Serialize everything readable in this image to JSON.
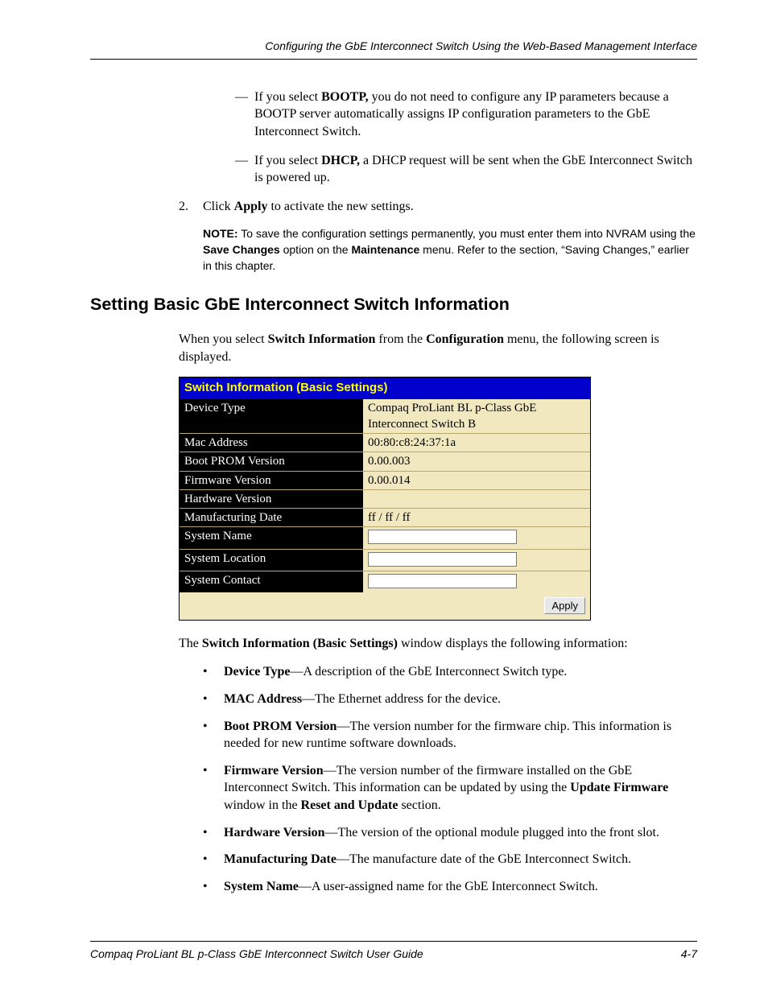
{
  "header": {
    "title": "Configuring the GbE Interconnect Switch Using the Web-Based Management Interface"
  },
  "footer": {
    "left": "Compaq ProLiant BL p-Class GbE Interconnect Switch User Guide",
    "right": "4-7"
  },
  "pre_list": {
    "item_a_prefix": "If you select ",
    "item_a_bold": "BOOTP,",
    "item_a_rest": " you do not need to configure any IP parameters because a BOOTP server automatically assigns IP configuration parameters to the GbE Interconnect Switch.",
    "item_b_prefix": "If you select ",
    "item_b_bold": "DHCP,",
    "item_b_rest": " a DHCP request will be sent when the GbE Interconnect Switch is powered up."
  },
  "step2": {
    "num": "2.",
    "prefix": "Click ",
    "bold": "Apply",
    "rest": " to activate the new settings."
  },
  "note": {
    "label": "NOTE:",
    "text1": "  To save the configuration settings permanently, you must enter them into NVRAM using the ",
    "bold1": "Save Changes",
    "text2": " option on the ",
    "bold2": "Maintenance",
    "text3": " menu. Refer to the section, “Saving Changes,” earlier in this chapter."
  },
  "section_title": "Setting Basic GbE Interconnect Switch Information",
  "intro": {
    "p1a": "When you select ",
    "p1b": "Switch Information",
    "p1c": " from the ",
    "p1d": "Configuration",
    "p1e": " menu, the following screen is displayed."
  },
  "panel": {
    "title": "Switch Information (Basic Settings)",
    "rows": [
      {
        "label": "Device Type",
        "value": "Compaq ProLiant BL p-Class GbE Interconnect Switch B",
        "input": false
      },
      {
        "label": "Mac Address",
        "value": "00:80:c8:24:37:1a",
        "input": false
      },
      {
        "label": "Boot PROM Version",
        "value": "0.00.003",
        "input": false
      },
      {
        "label": "Firmware Version",
        "value": "0.00.014",
        "input": false
      },
      {
        "label": "Hardware Version",
        "value": "",
        "input": false
      },
      {
        "label": "Manufacturing Date",
        "value": "ff / ff / ff",
        "input": false
      },
      {
        "label": "System Name",
        "value": "",
        "input": true
      },
      {
        "label": "System Location",
        "value": "",
        "input": true
      },
      {
        "label": "System Contact",
        "value": "",
        "input": true
      }
    ],
    "apply": "Apply"
  },
  "post_panel": {
    "p_a": "The ",
    "p_b": "Switch Information (Basic Settings)",
    "p_c": " window displays the following information:"
  },
  "info_list": [
    {
      "bold": "Device Type",
      "rest": "—A description of the GbE Interconnect Switch type."
    },
    {
      "bold": "MAC Address",
      "rest": "—The Ethernet address for the device."
    },
    {
      "bold": "Boot PROM Version",
      "rest": "—The version number for the firmware chip. This information is needed for new runtime software downloads."
    },
    {
      "bold": "Firmware Version",
      "rest": "—The version number of the firmware installed on the GbE Interconnect Switch. This information can be updated by using the ",
      "bold2": "Update Firmware",
      "rest2": " window in the ",
      "bold3": "Reset and Update",
      "rest3": " section."
    },
    {
      "bold": "Hardware Version",
      "rest": "—The version of the optional module plugged into the front slot."
    },
    {
      "bold": "Manufacturing Date",
      "rest": "—The manufacture date of the GbE Interconnect Switch."
    },
    {
      "bold": "System Name",
      "rest": "—A user-assigned name for the GbE Interconnect Switch."
    }
  ]
}
